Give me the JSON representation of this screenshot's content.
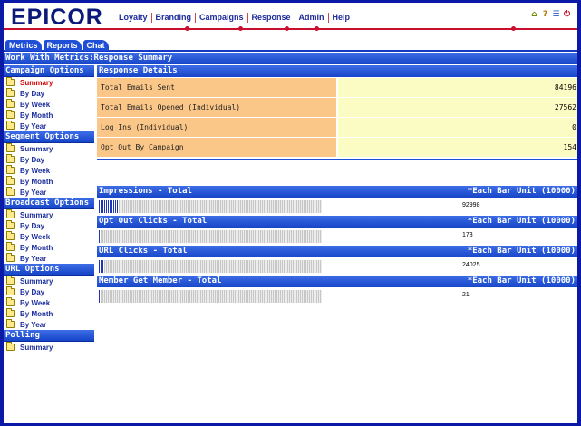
{
  "header": {
    "logo": "EPICOR",
    "nav": [
      "Loyalty",
      "Branding",
      "Campaigns",
      "Response",
      "Admin",
      "Help"
    ],
    "icons": [
      "home-icon",
      "help-icon",
      "window-icon",
      "power-icon"
    ]
  },
  "tabs": [
    "Metrics",
    "Reports",
    "Chat"
  ],
  "page_title": "Work With Metrics:Response Summary",
  "sidebar": {
    "sections": [
      {
        "title": "Campaign Options",
        "items": [
          "Summary",
          "By Day",
          "By Week",
          "By Month",
          "By Year"
        ],
        "active": 0
      },
      {
        "title": "Segment Options",
        "items": [
          "Summary",
          "By Day",
          "By Week",
          "By Month",
          "By Year"
        ]
      },
      {
        "title": "Broadcast Options",
        "items": [
          "Summary",
          "By Day",
          "By Week",
          "By Month",
          "By Year"
        ]
      },
      {
        "title": "URL Options",
        "items": [
          "Summary",
          "By Day",
          "By Week",
          "By Month",
          "By Year"
        ]
      },
      {
        "title": "Polling",
        "items": [
          "Summary"
        ]
      }
    ]
  },
  "response": {
    "title": "Response Details",
    "rows": [
      {
        "label": "Total Emails Sent",
        "value": "84196"
      },
      {
        "label": "Total Emails Opened (Individual)",
        "value": "27562"
      },
      {
        "label": "Log Ins (Individual)",
        "value": "0"
      },
      {
        "label": "Opt Out By Campaign",
        "value": "154"
      }
    ]
  },
  "metrics": [
    {
      "title": "Impressions - Total",
      "unit": "*Each Bar Unit (10000)",
      "value": "92998",
      "fill_fraction": 0.09
    },
    {
      "title": "Opt Out Clicks - Total",
      "unit": "*Each Bar Unit (10000)",
      "value": "173",
      "fill_fraction": 0.005
    },
    {
      "title": "URL Clicks - Total",
      "unit": "*Each Bar Unit (10000)",
      "value": "24025",
      "fill_fraction": 0.025
    },
    {
      "title": "Member Get Member - Total",
      "unit": "*Each Bar Unit (10000)",
      "value": "21",
      "fill_fraction": 0.0
    }
  ],
  "colors": {
    "frame": "#0a1aa6",
    "header_bar": "#1745c8",
    "label_cell": "#fbc788",
    "value_cell": "#fbfbc4",
    "active_item": "#d40000",
    "accent_line": "#c8102e"
  }
}
